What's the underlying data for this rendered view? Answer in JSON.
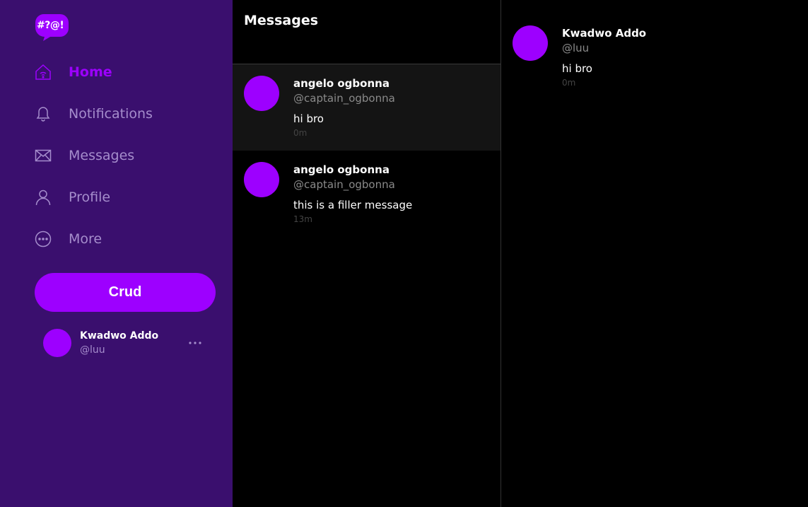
{
  "brand": {
    "logo_text": "#?@!",
    "accent_color": "#9d00ff",
    "sidebar_bg": "#3a0f6e"
  },
  "sidebar": {
    "items": [
      {
        "label": "Home",
        "icon": "home-icon",
        "active": true
      },
      {
        "label": "Notifications",
        "icon": "bell-icon",
        "active": false
      },
      {
        "label": "Messages",
        "icon": "mail-icon",
        "active": false
      },
      {
        "label": "Profile",
        "icon": "user-icon",
        "active": false
      },
      {
        "label": "More",
        "icon": "more-circle-icon",
        "active": false
      }
    ],
    "action_button": "Crud",
    "account": {
      "name": "Kwadwo Addo",
      "handle": "@luu",
      "menu_icon": "more-horizontal-icon"
    }
  },
  "messages": {
    "title": "Messages",
    "list": [
      {
        "name": "angelo ogbonna",
        "handle": "@captain_ogbonna",
        "text": "hi bro",
        "time": "0m",
        "selected": true
      },
      {
        "name": "angelo ogbonna",
        "handle": "@captain_ogbonna",
        "text": "this is a filler message",
        "time": "13m",
        "selected": false
      }
    ]
  },
  "detail": {
    "name": "Kwadwo Addo",
    "handle": "@luu",
    "text": "hi bro",
    "time": "0m"
  }
}
